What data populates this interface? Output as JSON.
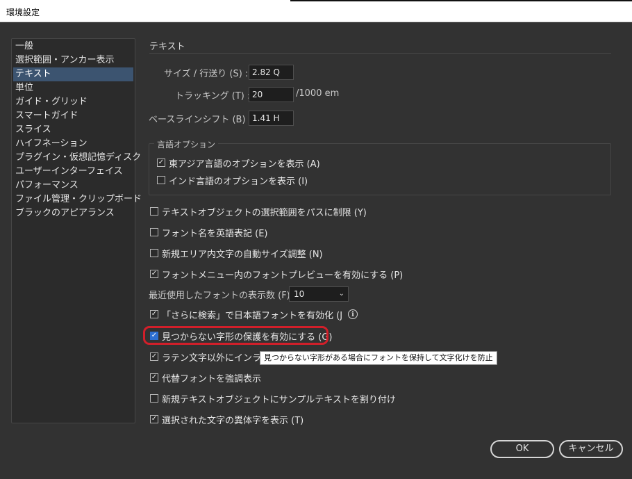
{
  "window": {
    "title": "環境設定"
  },
  "sidebar": {
    "items": [
      {
        "label": "一般"
      },
      {
        "label": "選択範囲・アンカー表示"
      },
      {
        "label": "テキスト"
      },
      {
        "label": "単位"
      },
      {
        "label": "ガイド・グリッド"
      },
      {
        "label": "スマートガイド"
      },
      {
        "label": "スライス"
      },
      {
        "label": "ハイフネーション"
      },
      {
        "label": "プラグイン・仮想記憶ディスク"
      },
      {
        "label": "ユーザーインターフェイス"
      },
      {
        "label": "パフォーマンス"
      },
      {
        "label": "ファイル管理・クリップボード"
      },
      {
        "label": "ブラックのアピアランス"
      }
    ],
    "selected": "テキスト"
  },
  "main": {
    "section_title": "テキスト",
    "size_leading": {
      "label": "サイズ / 行送り (S) :",
      "value": "2.82 Q"
    },
    "tracking": {
      "label": "トラッキング (T) :",
      "value": "20",
      "unit": "/1000 em"
    },
    "baseline_shift": {
      "label": "ベースラインシフト (B) :",
      "value": "1.41 H"
    },
    "language_options": {
      "title": "言語オプション",
      "east_asian": {
        "label": "東アジア言語のオプションを表示 (A)",
        "checked": true
      },
      "indic": {
        "label": "インド言語のオプションを表示 (I)",
        "checked": false
      }
    },
    "options": {
      "limit_selection": {
        "label": "テキストオブジェクトの選択範囲をパスに制限 (Y)",
        "checked": false
      },
      "english_font_names": {
        "label": "フォント名を英語表記 (E)",
        "checked": false
      },
      "auto_size": {
        "label": "新規エリア内文字の自動サイズ調整 (N)",
        "checked": false
      },
      "font_preview": {
        "label": "フォントメニュー内のフォントプレビューを有効にする (P)",
        "checked": true
      },
      "recent_fonts": {
        "label": "最近使用したフォントの表示数 (F) :",
        "value": "10"
      },
      "japanese_font_search": {
        "label": "「さらに検索」で日本語フォントを有効化 (J",
        "checked": true
      },
      "missing_glyph": {
        "label": "見つからない字形の保護を有効にする (G)",
        "checked": true
      },
      "inline_input": {
        "label": "ラテン文字以外にインライ",
        "checked": true
      },
      "highlight_substituted": {
        "label": "代替フォントを強調表示",
        "checked": true
      },
      "sample_text": {
        "label": "新規テキストオブジェクトにサンプルテキストを割り付け",
        "checked": false
      },
      "show_variants": {
        "label": "選択された文字の異体字を表示 (T)",
        "checked": true
      }
    },
    "tooltip": "見つからない字形がある場合にフォントを保持して文字化けを防止"
  },
  "buttons": {
    "ok": "OK",
    "cancel": "キャンセル"
  },
  "colors": {
    "background": "#323232",
    "selected": "#3c5470",
    "highlight_border": "#d21f2a",
    "check_accent": "#2d6fd2"
  }
}
